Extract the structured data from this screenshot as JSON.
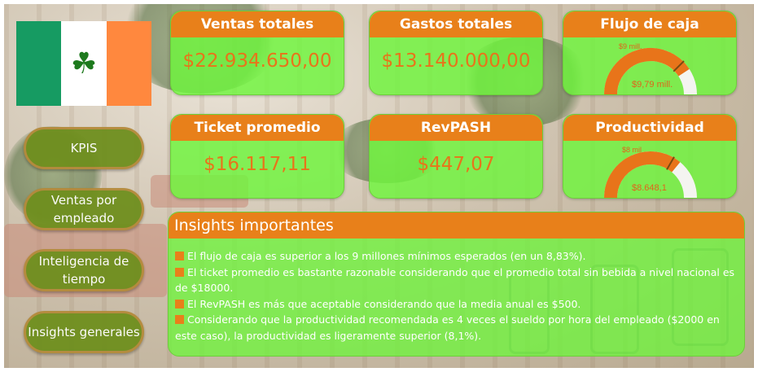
{
  "sidebar": {
    "nav": [
      {
        "label": "KPIS"
      },
      {
        "label": "Ventas por empleado"
      },
      {
        "label": "Inteligencia de tiempo"
      },
      {
        "label": "Insights generales"
      }
    ]
  },
  "kpis": {
    "ventas_totales": {
      "title": "Ventas totales",
      "value": "$22.934.650,00"
    },
    "gastos_totales": {
      "title": "Gastos totales",
      "value": "$13.140.000,00"
    },
    "flujo_de_caja": {
      "title": "Flujo de caja",
      "target_label": "$9 mill.",
      "value_label": "$9,79 mill.",
      "target": 9,
      "value": 9.79,
      "max": 12
    },
    "ticket_promedio": {
      "title": "Ticket promedio",
      "value": "$16.117,11"
    },
    "revpash": {
      "title": "RevPASH",
      "value": "$447,07"
    },
    "productividad": {
      "title": "Productividad",
      "target_label": "$8 mil",
      "value_label": "$8.648,1",
      "target": 8000,
      "value": 8648.1,
      "max": 12000
    }
  },
  "insights": {
    "title": "Insights importantes",
    "items": [
      "El flujo de caja es superior a los 9 millones mínimos esperados (en un 8,83%).",
      "El ticket promedio es bastante razonable considerando que el promedio total sin bebida a nivel nacional es de $18000.",
      "El RevPASH es más que aceptable considerando que la media anual es $500.",
      "Considerando que la productividad recomendada es 4 veces el sueldo por hora del empleado ($2000 en este caso), la productividad es ligeramente superior (8,1%)."
    ]
  },
  "colors": {
    "accent": "#e8801a",
    "card_bg": "#6ef53c",
    "nav_bg": "#6f8f1e",
    "gauge_fill": "#e8741a"
  }
}
